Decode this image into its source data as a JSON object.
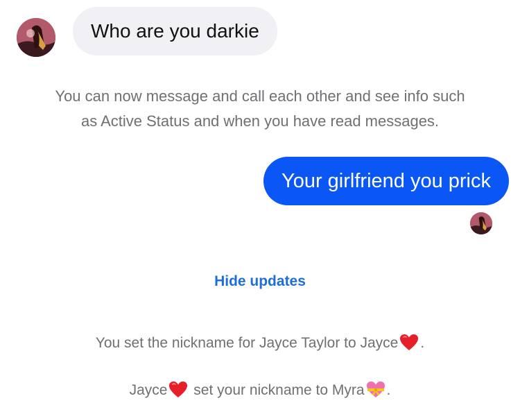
{
  "messages": {
    "incoming_text": "Who are you darkie",
    "outgoing_text": "Your girlfriend you prick"
  },
  "system": {
    "info_line1": "You can now message and call each other and see info such",
    "info_line2": "as Active Status and when you have read messages.",
    "hide_updates": "Hide updates",
    "update1_before": "You set the nickname for Jayce Taylor to Jayce",
    "update1_after": ".",
    "update2_name": "Jayce",
    "update2_mid": " set your nickname to Myra",
    "update2_after": "."
  },
  "icons": {
    "heart": "red-heart-icon",
    "heart_ribbon": "heart-with-ribbon-icon"
  },
  "colors": {
    "outgoing_bubble": "#0a57f5",
    "incoming_bubble": "#f0f0f5",
    "link": "#1d6fd8",
    "system_text": "#6f6f74"
  }
}
